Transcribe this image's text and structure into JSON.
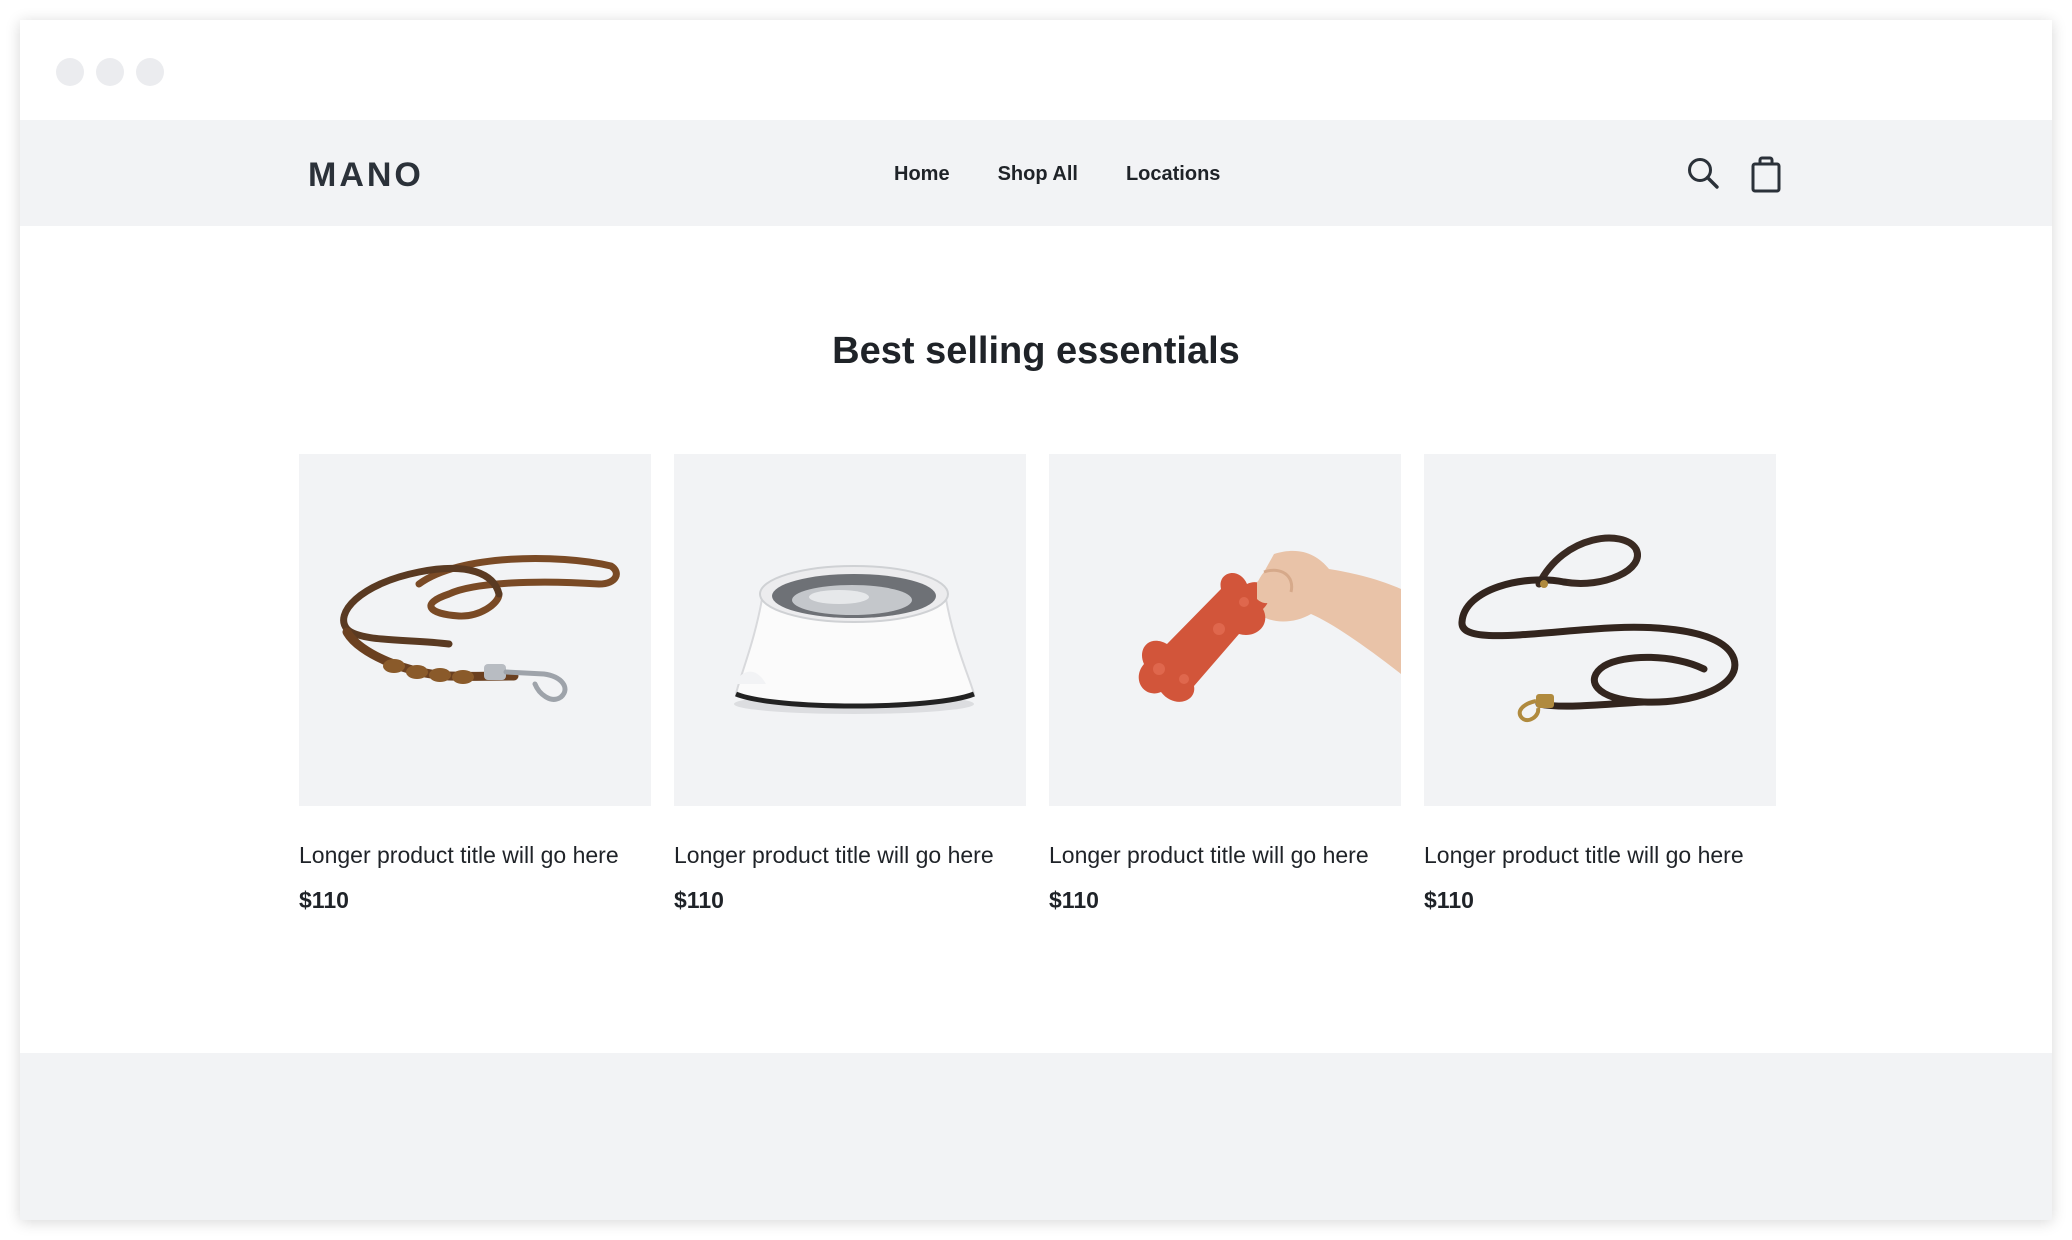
{
  "header": {
    "logo": "MANO",
    "nav": [
      "Home",
      "Shop All",
      "Locations"
    ],
    "icons": [
      "search-icon",
      "shopping-bag-icon"
    ]
  },
  "section": {
    "title": "Best selling essentials"
  },
  "products": [
    {
      "title": "Longer product title will go here",
      "price": "$110",
      "image": "braided-leather-leash"
    },
    {
      "title": "Longer product title will go here",
      "price": "$110",
      "image": "white-dog-bowl"
    },
    {
      "title": "Longer product title will go here",
      "price": "$110",
      "image": "bone-toy-in-hand"
    },
    {
      "title": "Longer product title will go here",
      "price": "$110",
      "image": "dark-leather-leash"
    }
  ],
  "colors": {
    "header_bg": "#f2f3f5",
    "text": "#1f2328",
    "image_bg": "#f2f3f5"
  }
}
